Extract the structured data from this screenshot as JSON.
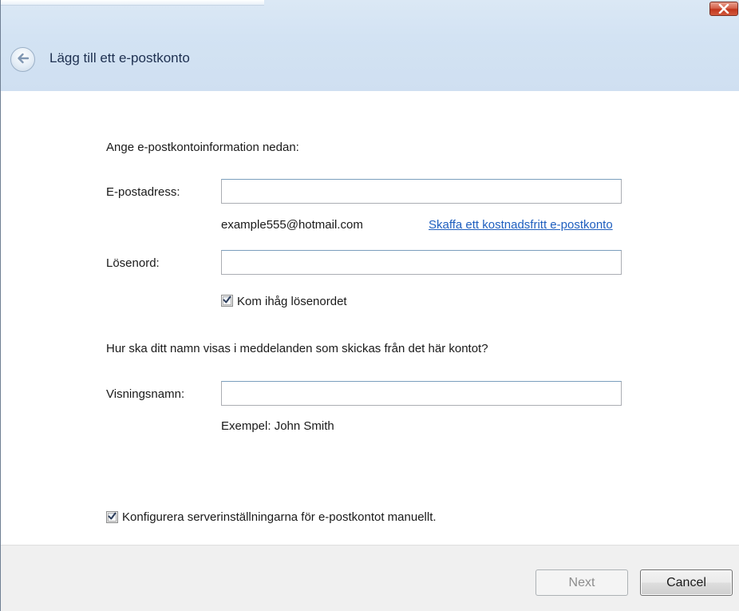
{
  "window": {
    "title": "Lägg till ett e-postkonto"
  },
  "form": {
    "intro": "Ange e-postkontoinformation nedan:",
    "email_label": "E-postadress:",
    "email_value": "",
    "email_example": "example555@hotmail.com",
    "free_account_link": "Skaffa ett kostnadsfritt e-postkonto",
    "password_label": "Lösenord:",
    "password_value": "",
    "remember_password_label": "Kom ihåg lösenordet",
    "remember_password_checked": true,
    "display_name_question": "Hur ska ditt namn visas i meddelanden som skickas från det här kontot?",
    "display_name_label": "Visningsnamn:",
    "display_name_value": "",
    "display_name_example": "Exempel: John Smith",
    "manual_config_label": "Konfigurera serverinställningarna för e-postkontot manuellt.",
    "manual_config_checked": true
  },
  "footer": {
    "next_label": "Next",
    "cancel_label": "Cancel"
  },
  "colors": {
    "link": "#1f5fbf",
    "title": "#1e3050",
    "close_button": "#c1351c"
  }
}
